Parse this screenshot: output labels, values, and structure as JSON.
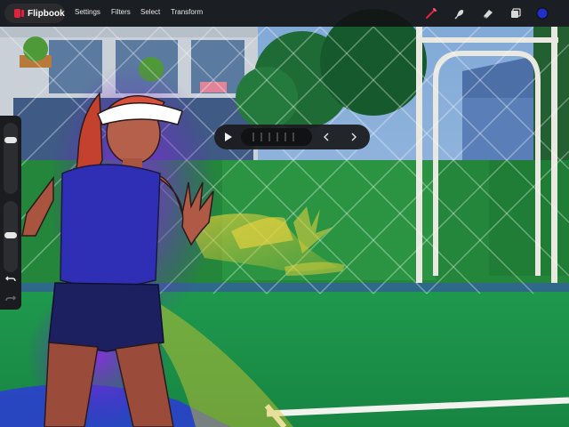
{
  "app": {
    "name": "Flipbook"
  },
  "menu": {
    "settings": "Settings",
    "filters": "Filters",
    "select": "Select",
    "transform": "Transform"
  },
  "tools": [
    "brush-icon",
    "smudge-icon",
    "eraser-icon",
    "layers-icon",
    "color-swatch"
  ],
  "colors": {
    "accent": "#e0213f",
    "active_color": "#1f30c8",
    "toolbar_bg": "#121214"
  },
  "sidebar": {
    "brush_size": 0.78,
    "opacity": 0.52
  },
  "playback": {
    "frame_ticks": 6
  }
}
